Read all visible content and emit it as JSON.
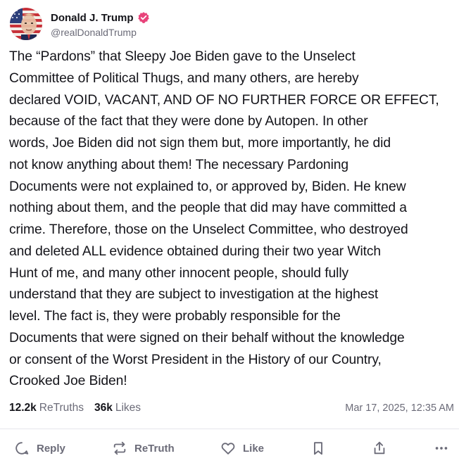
{
  "post": {
    "author": {
      "display_name": "Donald J. Trump",
      "handle": "@realDonaldTrump",
      "verified": true,
      "verified_color": "#e8437a"
    },
    "body_lines": [
      "The “Pardons” that Sleepy Joe Biden gave to the Unselect",
      "Committee of Political Thugs, and many others, are hereby",
      "declared VOID, VACANT, AND OF NO FURTHER FORCE OR EFFECT,",
      "because of the fact that they were done by Autopen. In other",
      "words, Joe Biden did not sign them but, more importantly, he did",
      "not know anything about them! The necessary Pardoning",
      "Documents were not explained to, or approved by, Biden. He knew",
      "nothing about them, and the people that did may have committed a",
      "crime. Therefore, those on the Unselect Committee, who destroyed",
      "and deleted ALL evidence obtained during their two year Witch",
      "Hunt of me, and many other innocent people, should fully",
      "understand that they are subject to investigation at the highest",
      "level. The fact is, they were probably responsible for the",
      "Documents that were signed on their behalf without the knowledge",
      "or consent of the Worst President in the History of our Country,",
      "Crooked Joe Biden!"
    ],
    "stats": {
      "retruths_count": "12.2k",
      "retruths_label": "ReTruths",
      "likes_count": "36k",
      "likes_label": "Likes"
    },
    "timestamp": "Mar 17, 2025, 12:35 AM"
  },
  "actions": {
    "reply_label": "Reply",
    "retruth_label": "ReTruth",
    "like_label": "Like"
  },
  "icons": {
    "reply": "speech-bubble-icon",
    "retruth": "repost-arrows-icon",
    "like": "heart-icon",
    "bookmark": "bookmark-icon",
    "share": "share-upload-icon",
    "more": "more-dots-icon",
    "verified": "verified-badge-icon"
  }
}
